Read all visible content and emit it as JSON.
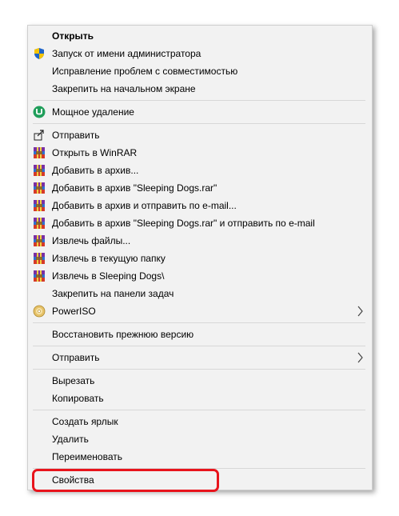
{
  "menu": {
    "items": [
      {
        "label": "Открыть",
        "bold": true,
        "icon": null
      },
      {
        "label": "Запуск от имени администратора",
        "icon": "shield-icon"
      },
      {
        "label": "Исправление проблем с совместимостью",
        "icon": null
      },
      {
        "label": "Закрепить на начальном экране",
        "icon": null
      },
      {
        "separator": true
      },
      {
        "label": "Мощное удаление",
        "icon": "uninstaller-icon"
      },
      {
        "separator": true
      },
      {
        "label": "Отправить",
        "icon": "share-icon"
      },
      {
        "label": "Открыть в WinRAR",
        "icon": "winrar-icon"
      },
      {
        "label": "Добавить в архив...",
        "icon": "winrar-icon"
      },
      {
        "label": "Добавить в архив \"Sleeping Dogs.rar\"",
        "icon": "winrar-icon"
      },
      {
        "label": "Добавить в архив и отправить по e-mail...",
        "icon": "winrar-icon"
      },
      {
        "label": "Добавить в архив \"Sleeping Dogs.rar\" и отправить по e-mail",
        "icon": "winrar-icon"
      },
      {
        "label": "Извлечь файлы...",
        "icon": "winrar-icon"
      },
      {
        "label": "Извлечь в текущую папку",
        "icon": "winrar-icon"
      },
      {
        "label": "Извлечь в Sleeping Dogs\\",
        "icon": "winrar-icon"
      },
      {
        "label": "Закрепить на панели задач",
        "icon": null
      },
      {
        "label": "PowerISO",
        "icon": "poweriso-disc-icon",
        "submenu": true
      },
      {
        "separator": true
      },
      {
        "label": "Восстановить прежнюю версию",
        "icon": null
      },
      {
        "separator": true
      },
      {
        "label": "Отправить",
        "icon": null,
        "submenu": true
      },
      {
        "separator": true
      },
      {
        "label": "Вырезать",
        "icon": null
      },
      {
        "label": "Копировать",
        "icon": null
      },
      {
        "separator": true
      },
      {
        "label": "Создать ярлык",
        "icon": null
      },
      {
        "label": "Удалить",
        "icon": null
      },
      {
        "label": "Переименовать",
        "icon": null
      },
      {
        "separator": true
      },
      {
        "label": "Свойства",
        "icon": null,
        "highlighted": true
      }
    ]
  },
  "colors": {
    "menu_background": "#f2f2f2",
    "separator": "#d7d7d7",
    "highlight_border": "#e8141c",
    "uninstaller_green": "#1f9e5a"
  }
}
